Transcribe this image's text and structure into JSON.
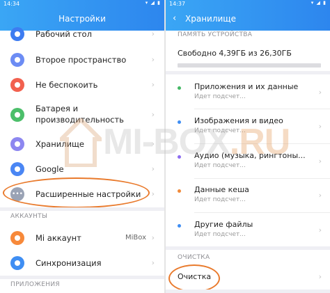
{
  "left": {
    "status_time": "14:34",
    "status_icons": "▾ ◢ ▮",
    "title": "Настройки",
    "items": [
      {
        "label": "Рабочий стол",
        "color": "#3d7cf1"
      },
      {
        "label": "Второе пространство",
        "color": "#6c8cf4"
      },
      {
        "label": "Не беспокоить",
        "color": "#f2614f"
      },
      {
        "label": "Батарея и\nпроизводительность",
        "color": "#4cbf6a"
      },
      {
        "label": "Хранилище",
        "color": "#8d87f0"
      },
      {
        "label": "Google",
        "color": "#4a86f4"
      },
      {
        "label": "Расширенные настройки",
        "color": "#9aa3b5"
      }
    ],
    "accounts_section": "АККАУНТЫ",
    "accounts": [
      {
        "label": "Mi аккаунт",
        "value": "MiBox",
        "color": "#f7893a"
      },
      {
        "label": "Синхронизация",
        "color": "#3f8ef3"
      }
    ],
    "apps_section": "ПРИЛОЖЕНИЯ"
  },
  "right": {
    "status_time": "14:37",
    "status_icons": "▾ ◢ ▮",
    "title": "Хранилище",
    "memory_section": "ПАМЯТЬ УСТРОЙСТВА",
    "free_text": "Свободно 4,39ГБ из 26,30ГБ",
    "categories": [
      {
        "name": "Приложения и их данные",
        "sub": "Идет подсчет...",
        "color": "#45b865"
      },
      {
        "name": "Изображения и видео",
        "sub": "Идет подсчет...",
        "color": "#3f8ef3"
      },
      {
        "name": "Аудио (музыка, рингтоны...",
        "sub": "Идет подсчет...",
        "color": "#8d6cf0"
      },
      {
        "name": "Данные кеша",
        "sub": "Идет подсчет...",
        "color": "#f08a3a"
      },
      {
        "name": "Другие файлы",
        "sub": "Идет подсчет...",
        "color": "#3f8ef3"
      }
    ],
    "cleanup_section": "ОЧИСТКА",
    "cleanup_label": "Очистка"
  },
  "watermark": {
    "main": "MI-BOX",
    "suffix": ".RU"
  },
  "colors": {
    "accent": "#2d86ee",
    "highlight": "#e97a2c"
  }
}
